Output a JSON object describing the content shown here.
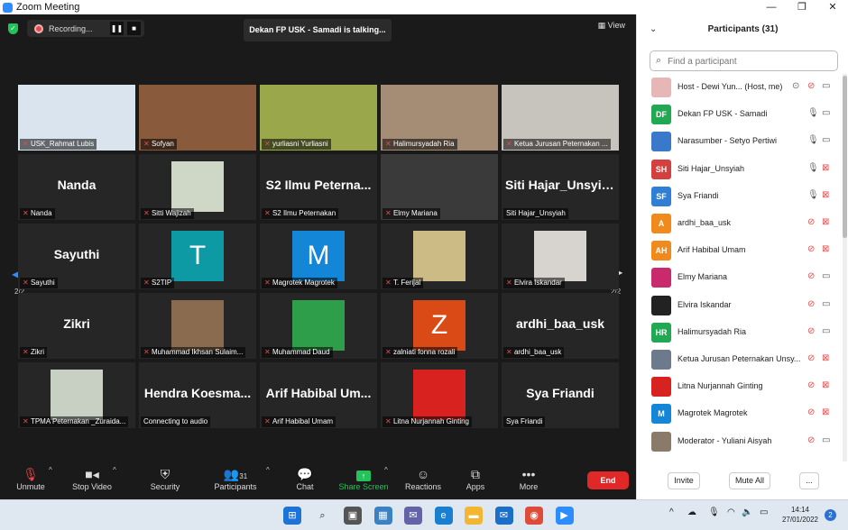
{
  "window": {
    "title": "Zoom Meeting",
    "minimize": "—",
    "maximize": "❐",
    "close": "✕"
  },
  "top": {
    "recording": "Recording...",
    "pause": "❚❚",
    "stop": "■",
    "talking": "Dekan FP USK - Samadi is talking...",
    "view": "View",
    "view_icon": "grid-icon"
  },
  "gallery": {
    "page_left": "2/2",
    "page_right": "2/2",
    "tiles": [
      {
        "name": "USK_Rahmat Lubis",
        "big": "",
        "video": true,
        "bg": "#d9e4ee",
        "muted": true
      },
      {
        "name": "Sofyan",
        "big": "",
        "video": true,
        "bg": "#8a5a3c",
        "muted": true
      },
      {
        "name": "yurliasni Yurliasni",
        "big": "",
        "video": true,
        "bg": "#9aa74a",
        "muted": true
      },
      {
        "name": "Halimursyadah Ria",
        "big": "",
        "video": true,
        "bg": "#a58c74",
        "muted": true
      },
      {
        "name": "Ketua Jurusan Peternakan ...",
        "big": "",
        "video": true,
        "bg": "#c7c3bd",
        "muted": true
      },
      {
        "name": "Nanda",
        "big": "Nanda",
        "video": false,
        "bg": "",
        "muted": true
      },
      {
        "name": "Sitti Wajizah",
        "big": "",
        "video": true,
        "bg": "#cfd8c6",
        "muted": true,
        "avatar": true
      },
      {
        "name": "S2 Ilmu Peternakan",
        "big": "S2 Ilmu Peterna...",
        "video": false,
        "bg": "",
        "muted": true
      },
      {
        "name": "Elmy Mariana",
        "big": "",
        "video": true,
        "bg": "#3a3a3a",
        "muted": true
      },
      {
        "name": "Siti Hajar_Unsyiah",
        "big": "Siti Hajar_Unsyiah",
        "video": false,
        "bg": "",
        "muted": false
      },
      {
        "name": "Sayuthi",
        "big": "Sayuthi",
        "video": false,
        "bg": "",
        "muted": true
      },
      {
        "name": "S2TIP",
        "big": "T",
        "video": false,
        "bg": "#0e9aa5",
        "muted": true,
        "avatar": true
      },
      {
        "name": "Magrotek Magrotek",
        "big": "M",
        "video": false,
        "bg": "#1486d8",
        "muted": true,
        "avatar": true
      },
      {
        "name": "T. Ferijal",
        "big": "",
        "video": true,
        "bg": "#cdbb86",
        "muted": true,
        "avatar": true
      },
      {
        "name": "Elvira Iskandar",
        "big": "",
        "video": true,
        "bg": "#d7d4d0",
        "muted": true,
        "avatar": true
      },
      {
        "name": "Zikri",
        "big": "Zikri",
        "video": false,
        "bg": "",
        "muted": true
      },
      {
        "name": "Muhammad Ikhsan Sulaim...",
        "big": "",
        "video": true,
        "bg": "#8a6b50",
        "muted": true,
        "avatar": true
      },
      {
        "name": "Muhammad Daud",
        "big": "",
        "video": true,
        "bg": "#2f9e4a",
        "muted": true,
        "avatar": true
      },
      {
        "name": "zalniati fonna rozali",
        "big": "Z",
        "video": false,
        "bg": "#d94a17",
        "muted": true,
        "avatar": true
      },
      {
        "name": "ardhi_baa_usk",
        "big": "ardhi_baa_usk",
        "video": false,
        "bg": "",
        "muted": true
      },
      {
        "name": "TPMA Peternakan _Zuraida...",
        "big": "",
        "video": true,
        "bg": "#c8d0c4",
        "muted": true,
        "avatar": true
      },
      {
        "name": "Connecting to audio",
        "big": "Hendra  Koesma...",
        "video": false,
        "bg": "",
        "muted": false
      },
      {
        "name": "Arif Habibal Umam",
        "big": "Arif Habibal Um...",
        "video": false,
        "bg": "",
        "muted": true
      },
      {
        "name": "Litna Nurjannah Ginting",
        "big": "",
        "video": true,
        "bg": "#d8221f",
        "muted": true,
        "avatar": true
      },
      {
        "name": "Sya Friandi",
        "big": "Sya Friandi",
        "video": false,
        "bg": "",
        "muted": false
      }
    ]
  },
  "toolbar": {
    "unmute": "Unmute",
    "stop_video": "Stop Video",
    "security": "Security",
    "participants": "Participants",
    "participant_count": "31",
    "chat": "Chat",
    "share": "Share Screen",
    "reactions": "Reactions",
    "apps": "Apps",
    "more": "More",
    "end": "End"
  },
  "panel": {
    "title": "Participants (31)",
    "search_placeholder": "Find a participant",
    "invite": "Invite",
    "mute_all": "Mute All",
    "more": "...",
    "participants": [
      {
        "initials": "",
        "name": "Host - Dewi Yun...  (Host, me)",
        "color": "#e7b7b7",
        "mic": "muted",
        "cam": "on",
        "extra": "⊙"
      },
      {
        "initials": "DF",
        "name": "Dekan FP USK - Samadi",
        "color": "#22a853",
        "mic": "on",
        "cam": "on"
      },
      {
        "initials": "",
        "name": "Narasumber - Setyo Pertiwi",
        "color": "#3a78c9",
        "mic": "on",
        "cam": "on"
      },
      {
        "initials": "SH",
        "name": "Siti Hajar_Unsyiah",
        "color": "#d43f3f",
        "mic": "on",
        "cam": "off"
      },
      {
        "initials": "SF",
        "name": "Sya Friandi",
        "color": "#2f7fd6",
        "mic": "on",
        "cam": "off"
      },
      {
        "initials": "A",
        "name": "ardhi_baa_usk",
        "color": "#f08a1c",
        "mic": "muted",
        "cam": "off"
      },
      {
        "initials": "AH",
        "name": "Arif Habibal Umam",
        "color": "#f08a1c",
        "mic": "muted",
        "cam": "off"
      },
      {
        "initials": "",
        "name": "Elmy Mariana",
        "color": "#c92a6d",
        "mic": "muted",
        "cam": "on"
      },
      {
        "initials": "",
        "name": "Elvira Iskandar",
        "color": "#222222",
        "mic": "muted",
        "cam": "on"
      },
      {
        "initials": "HR",
        "name": "Halimursyadah Ria",
        "color": "#22a853",
        "mic": "muted",
        "cam": "on"
      },
      {
        "initials": "",
        "name": "Ketua Jurusan Peternakan Unsy...",
        "color": "#6d7a8c",
        "mic": "muted",
        "cam": "off"
      },
      {
        "initials": "",
        "name": "Litna Nurjannah Ginting",
        "color": "#d8221f",
        "mic": "muted",
        "cam": "off"
      },
      {
        "initials": "M",
        "name": "Magrotek Magrotek",
        "color": "#1486d8",
        "mic": "muted",
        "cam": "off"
      },
      {
        "initials": "",
        "name": "Moderator - Yuliani Aisyah",
        "color": "#8a7a6a",
        "mic": "muted",
        "cam": "on"
      }
    ]
  },
  "taskbar": {
    "time": "14:14",
    "date": "27/01/2022",
    "notifications": "2",
    "apps": [
      "windows-icon",
      "search-icon",
      "task-view-icon",
      "widgets-icon",
      "chat-icon",
      "edge-icon",
      "file-explorer-icon",
      "mail-icon",
      "chrome-icon",
      "zoom-icon"
    ],
    "tray": [
      "chevron-up-icon",
      "cloud-icon",
      "microphone-icon",
      "wifi-icon",
      "speaker-icon",
      "battery-icon"
    ]
  },
  "colors": {
    "accent": "#2d8cff",
    "end": "#e02828",
    "muted": "#e54b4b",
    "share": "#23c25a"
  }
}
